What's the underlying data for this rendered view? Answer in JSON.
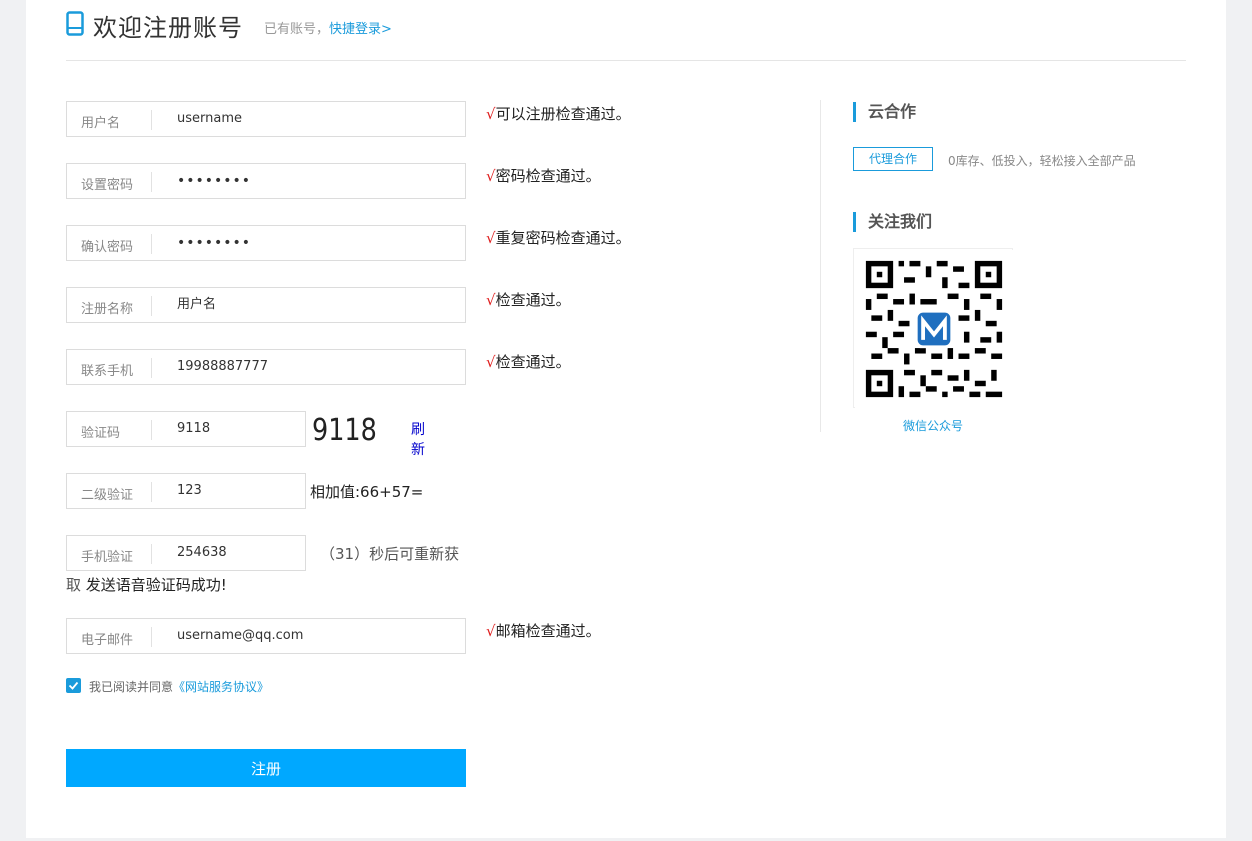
{
  "header": {
    "title": "欢迎注册账号",
    "has_account": "已有账号，",
    "login_link": "快捷登录>"
  },
  "form": {
    "username": {
      "label": "用户名",
      "value": "username",
      "msg": "可以注册检查通过。"
    },
    "password": {
      "label": "设置密码",
      "value": "••••••••",
      "msg": "密码检查通过。"
    },
    "confirm": {
      "label": "确认密码",
      "value": "••••••••",
      "msg": "重复密码检查通过。"
    },
    "regname": {
      "label": "注册名称",
      "value": "用户名",
      "msg": "检查通过。"
    },
    "mobile": {
      "label": "联系手机",
      "value": "19988887777",
      "msg": "检查通过。"
    },
    "captcha": {
      "label": "验证码",
      "value": "9118",
      "image_text": "9118",
      "refresh": "刷新"
    },
    "secondary": {
      "label": "二级验证",
      "value": "123",
      "hint": "相加值:66+57="
    },
    "phone_code": {
      "label": "手机验证",
      "value": "254638",
      "countdown": "（31）秒后可重新获",
      "countdown_cont": "取",
      "sent_msg": " 发送语音验证码成功!"
    },
    "email": {
      "label": "电子邮件",
      "value": "username@qq.com",
      "msg": "邮箱检查通过。"
    },
    "check_mark": "√",
    "agree_text": "我已阅读并同意",
    "agree_link": "《网站服务协议》",
    "submit": "注册"
  },
  "sidebar": {
    "coop_title": "云合作",
    "agent_button": "代理合作",
    "agent_desc": "0库存、低投入，轻松接入全部产品",
    "follow_title": "关注我们",
    "qr_caption": "微信公众号"
  },
  "colors": {
    "accent": "#1a9bdb",
    "submit": "#00a8ff",
    "check": "#e02020"
  }
}
